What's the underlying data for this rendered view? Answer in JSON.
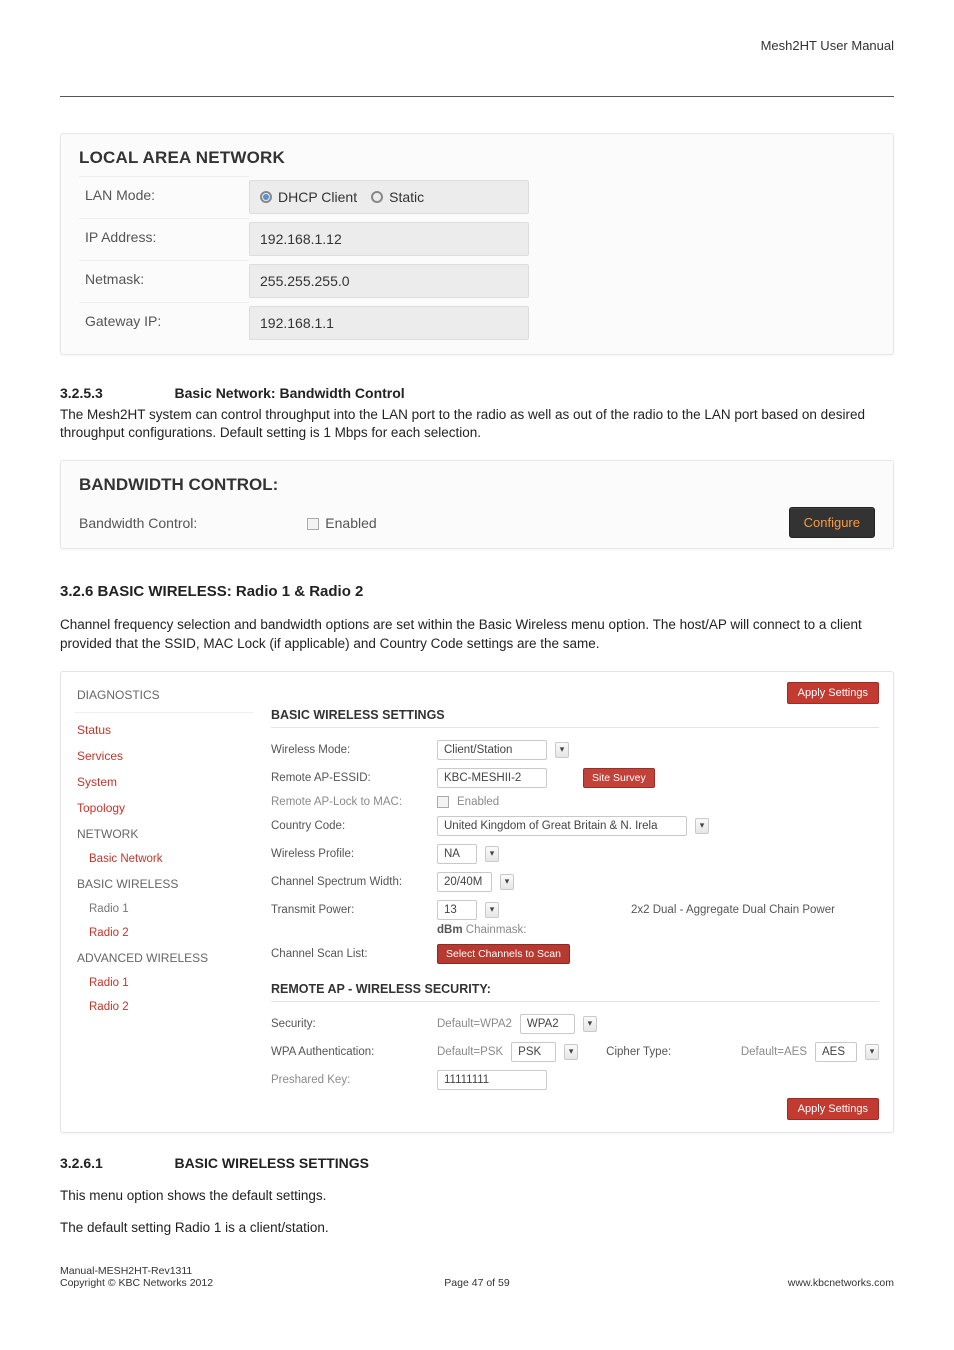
{
  "header": {
    "doc_title": "Mesh2HT User Manual"
  },
  "lan": {
    "title": "LOCAL AREA NETWORK",
    "rows": {
      "mode": {
        "label": "LAN Mode:",
        "opt1": "DHCP Client",
        "opt2": "Static"
      },
      "ip": {
        "label": "IP Address:",
        "value": "192.168.1.12"
      },
      "netmask": {
        "label": "Netmask:",
        "value": "255.255.255.0"
      },
      "gateway": {
        "label": "Gateway IP:",
        "value": "192.168.1.1"
      }
    }
  },
  "sec3253": {
    "num": "3.2.5.3",
    "title": "Basic Network: Bandwidth Control",
    "text": "The Mesh2HT system can control throughput into the LAN port to the radio as well as out of the radio to the LAN port based on desired throughput configurations. Default setting is 1 Mbps for each selection."
  },
  "bw": {
    "title": "BANDWIDTH CONTROL:",
    "row_label": "Bandwidth Control:",
    "enabled": "Enabled",
    "configure": "Configure"
  },
  "sec326": {
    "title": "3.2.6 BASIC WIRELESS: Radio 1 & Radio 2",
    "text": "Channel frequency selection and bandwidth options are set within the Basic Wireless menu option. The host/AP will connect to a client provided that the SSID, MAC Lock (if applicable) and Country Code settings are the same."
  },
  "wl": {
    "apply": "Apply Settings",
    "side": {
      "diagnostics": "DIAGNOSTICS",
      "status": "Status",
      "services": "Services",
      "system": "System",
      "topology": "Topology",
      "network": "NETWORK",
      "basic_network": "Basic Network",
      "basic_wireless": "BASIC WIRELESS",
      "radio1": "Radio 1",
      "radio2": "Radio 2",
      "adv_wireless": "ADVANCED WIRELESS",
      "adv_radio1": "Radio 1",
      "adv_radio2": "Radio 2"
    },
    "panel1": {
      "title": "BASIC WIRELESS SETTINGS",
      "wireless_mode": {
        "lbl": "Wireless Mode:",
        "val": "Client/Station"
      },
      "remote_essid": {
        "lbl": "Remote AP-ESSID:",
        "val": "KBC-MESHII-2",
        "survey": "Site Survey"
      },
      "remote_lock": {
        "lbl": "Remote AP-Lock to MAC:",
        "enabled": "Enabled"
      },
      "country": {
        "lbl": "Country Code:",
        "val": "United Kingdom of Great Britain & N. Irela"
      },
      "profile": {
        "lbl": "Wireless Profile:",
        "val": "NA"
      },
      "spectrum": {
        "lbl": "Channel Spectrum Width:",
        "val": "20/40M"
      },
      "txpower": {
        "lbl": "Transmit Power:",
        "val": "13",
        "dbm": "dBm",
        "chainmask": "Chainmask:",
        "note": "2x2 Dual - Aggregate Dual Chain Power"
      },
      "scanlist": {
        "lbl": "Channel Scan List:",
        "btn": "Select Channels to Scan"
      }
    },
    "panel2": {
      "title": "REMOTE AP - WIRELESS SECURITY:",
      "security": {
        "lbl": "Security:",
        "def": "Default=WPA2",
        "val": "WPA2"
      },
      "wpa_auth": {
        "lbl": "WPA Authentication:",
        "def": "Default=PSK",
        "val": "PSK",
        "cipher_lbl": "Cipher Type:",
        "cipher_def": "Default=AES",
        "cipher_val": "AES"
      },
      "psk": {
        "lbl": "Preshared Key:",
        "val": "11111111"
      }
    }
  },
  "sec3261": {
    "num": "3.2.6.1",
    "title": "BASIC WIRELESS SETTINGS",
    "p1": "This menu option shows the default settings.",
    "p2": "The default setting Radio 1 is a client/station."
  },
  "footer": {
    "l1": "Manual-MESH2HT-Rev1311",
    "l2": "Copyright © KBC Networks 2012",
    "center": "Page 47 of 59",
    "right": "www.kbcnetworks.com"
  },
  "chart_data": {
    "type": "table",
    "title": "LOCAL AREA NETWORK",
    "rows": [
      {
        "field": "LAN Mode",
        "value": "DHCP Client",
        "options": [
          "DHCP Client",
          "Static"
        ]
      },
      {
        "field": "IP Address",
        "value": "192.168.1.12"
      },
      {
        "field": "Netmask",
        "value": "255.255.255.0"
      },
      {
        "field": "Gateway IP",
        "value": "192.168.1.1"
      }
    ]
  }
}
